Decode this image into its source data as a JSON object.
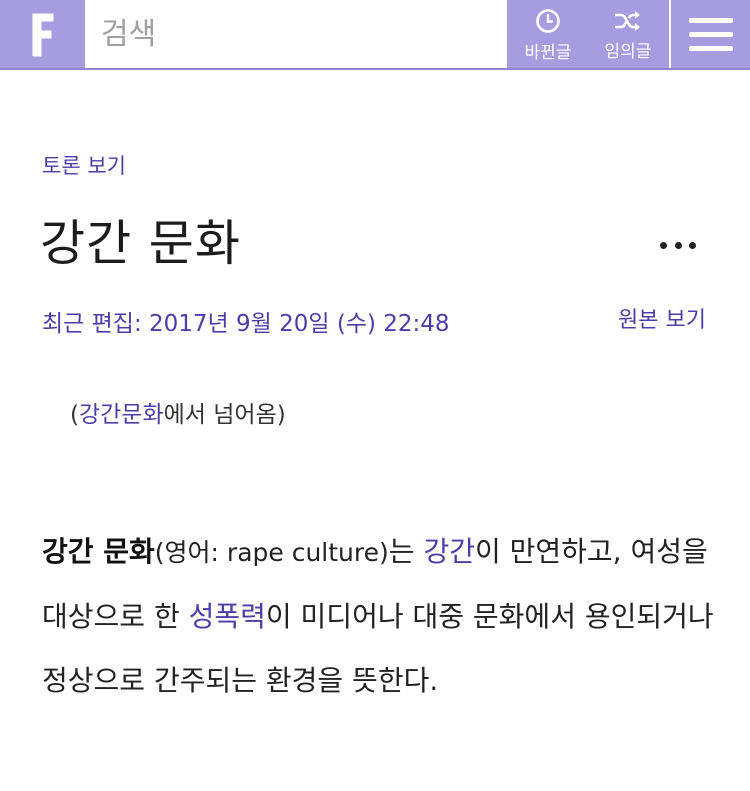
{
  "header": {
    "logo_letter": "F",
    "search_placeholder": "검색",
    "recent_label": "바뀐글",
    "random_label": "임의글",
    "accent_color": "#a69ce0"
  },
  "page": {
    "discussion_link": "토론 보기",
    "title": "강간 문화",
    "more_menu": "more-options",
    "last_edited": "최근 편집: 2017년 9월 20일 (수) 22:48",
    "view_source": "원본 보기",
    "redirect_open": "(",
    "redirect_link": "강간문화",
    "redirect_suffix": "에서 넘어옴)"
  },
  "article": {
    "term": "강간 문화",
    "paren": "(영어: rape culture)",
    "t1": "는 ",
    "link_rape": "강간",
    "t2": "이 만연하고, 여성을 대상으로 한 ",
    "link_sexual_violence": "성폭력",
    "t3": "이 미디어나 대중 문화에서 용인되거나 정상으로 간주되는 환경을 뜻한다."
  },
  "colors": {
    "link": "#4a3fa6",
    "text": "#222222"
  }
}
